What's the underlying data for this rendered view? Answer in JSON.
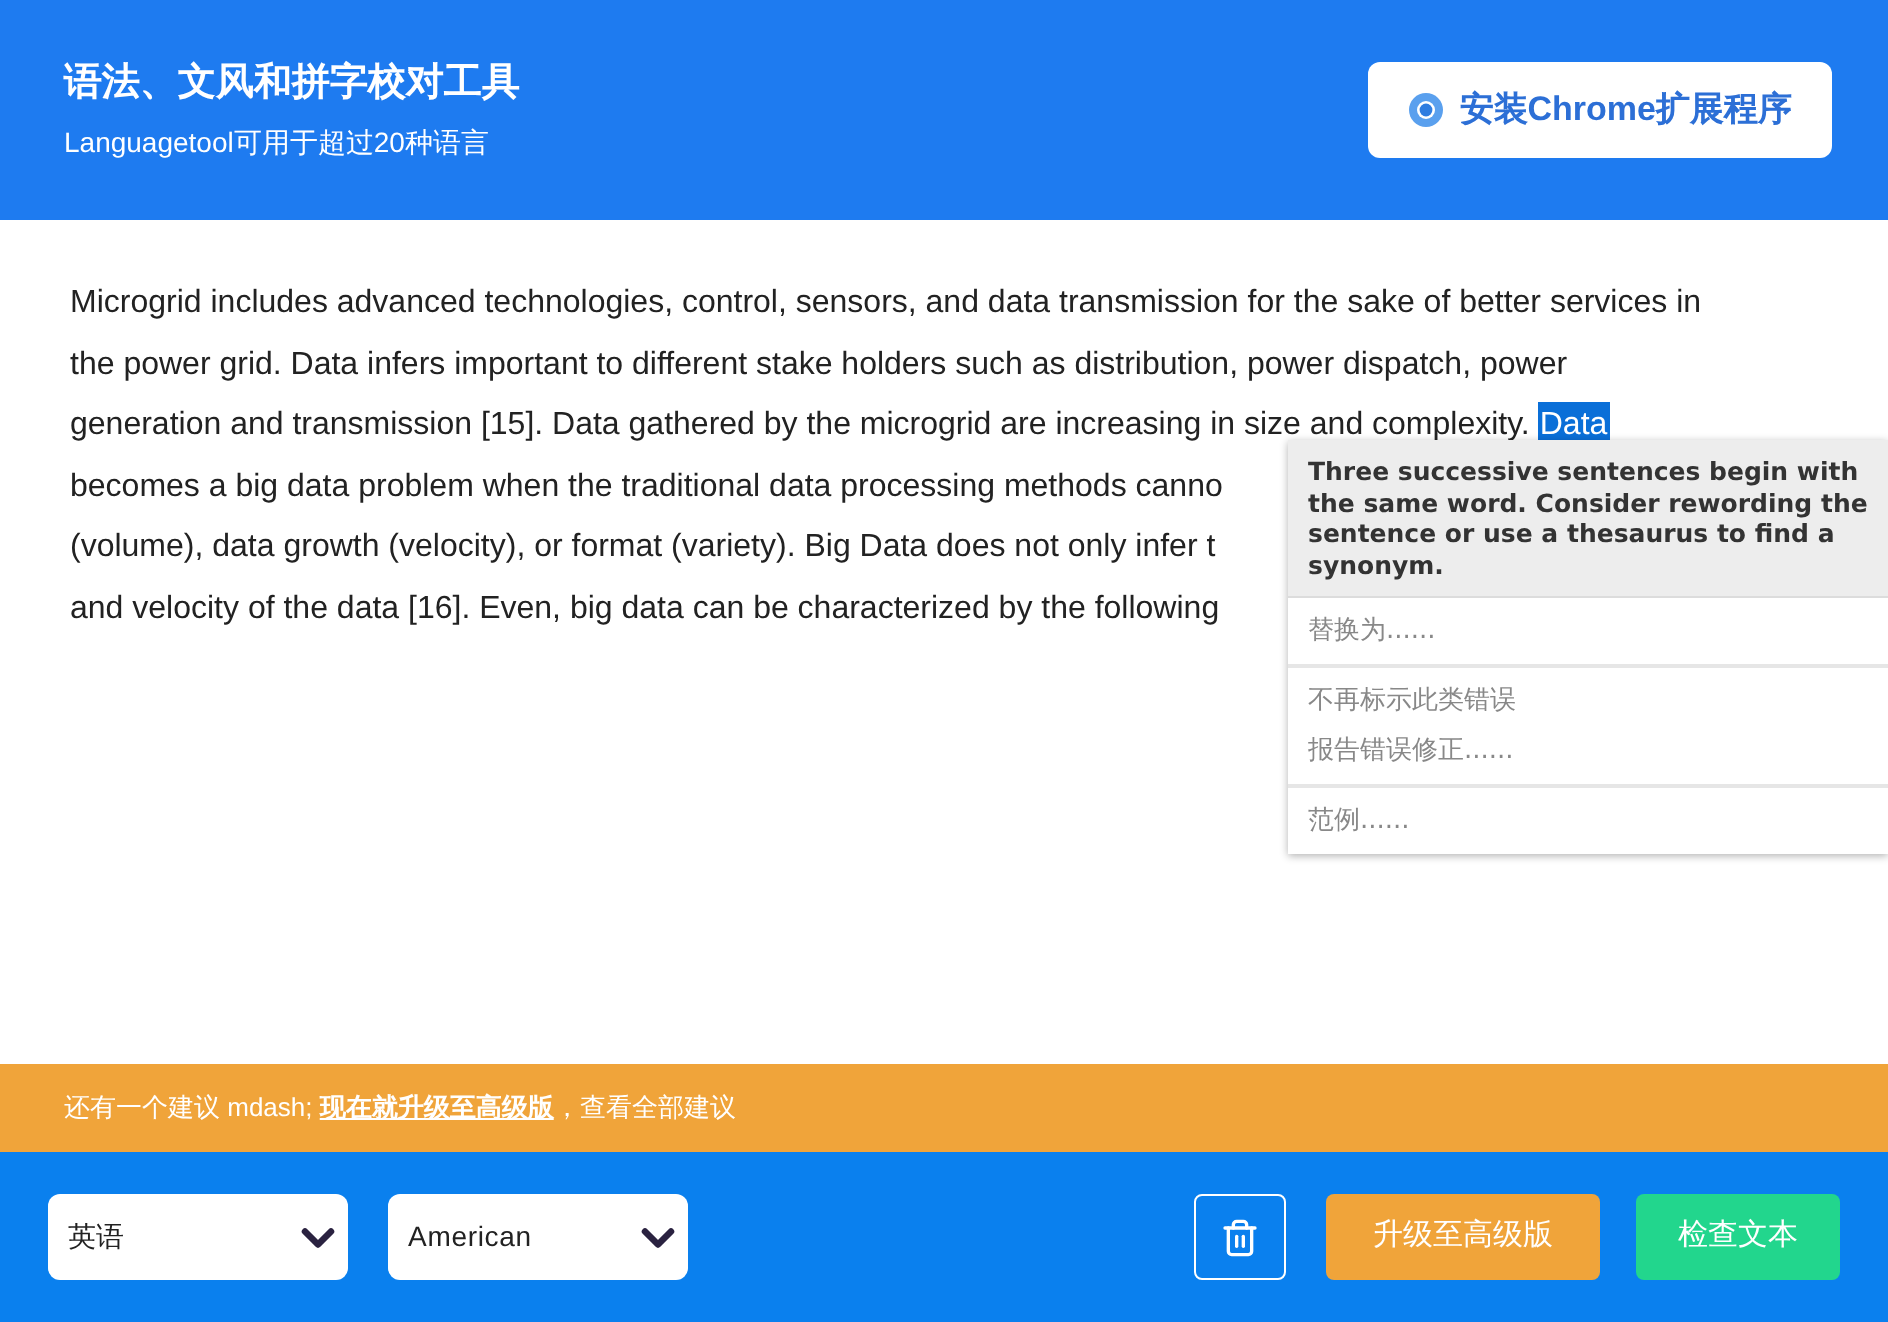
{
  "header": {
    "title": "语法、文风和拼字校对工具",
    "subtitle": "Languagetool可用于超过20种语言",
    "install_button": "安装Chrome扩展程序"
  },
  "editor": {
    "lines": [
      {
        "text": "Microgrid includes advanced technologies, control, sensors, and data transmission for the sake of better services in"
      },
      {
        "text": "the power grid. Data infers important to different stake holders such as distribution, power dispatch, power"
      },
      {
        "text": "generation and transmission [15]. Data gathered by the microgrid are increasing in size and complexity.",
        "highlight": "Data"
      },
      {
        "text": "becomes a big data problem when the traditional data processing methods canno"
      },
      {
        "text": "(volume), data growth (velocity), or format (variety). Big Data does not only infer t"
      },
      {
        "text": "and velocity of the data [16]. Even, big data can be characterized by the following"
      }
    ]
  },
  "popup": {
    "message": "Three successive sentences begin with the same word. Consider rewording the sentence or use a thesaurus to find a synonym.",
    "groups": [
      [
        "替换为......"
      ],
      [
        "不再标示此类错误",
        "报告错误修正......"
      ],
      [
        "范例......"
      ]
    ]
  },
  "notice": {
    "prefix": "还有一个建议 mdash; ",
    "link": "现在就升级至高级版",
    "suffix": "，查看全部建议"
  },
  "footer": {
    "language": "英语",
    "variant": "American",
    "upgrade_button": "升级至高级版",
    "check_button": "检查文本"
  }
}
